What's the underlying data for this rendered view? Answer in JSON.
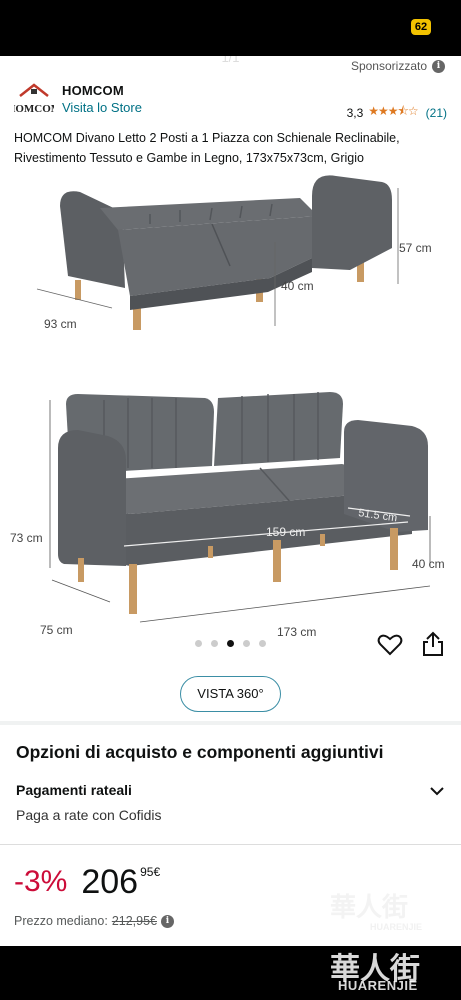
{
  "status_bar": {
    "battery": "62"
  },
  "carousel": {
    "pager": "1/1",
    "active_index": 3,
    "dot_count": 5
  },
  "ad": {
    "sponsored_label": "Sponsorizzato",
    "info_icon": "i"
  },
  "brand": {
    "name": "HOMCOM",
    "store_link": "Visita lo Store",
    "rating_value": "3,3",
    "rating_stars": "★★★⯪☆",
    "rating_count": "(21)"
  },
  "product": {
    "title": "HOMCOM Divano Letto 2 Posti a 1 Piazza con Schienale Reclinabile, Rivestimento Tessuto e Gambe in Legno, 173x75x73cm, Grigio"
  },
  "image_labels": {
    "bed_height": "57 cm",
    "bed_depth": "93 cm",
    "bed_leg_height": "40 cm",
    "sofa_height": "73 cm",
    "seat_width": "159 cm",
    "seat_depth": "51.5 cm",
    "seat_height": "40 cm",
    "sofa_depth": "75 cm",
    "sofa_width": "173 cm"
  },
  "buttons": {
    "vista_360": "VISTA 360°"
  },
  "options": {
    "title": "Opzioni di acquisto e componenti aggiuntivi",
    "payments_label": "Pagamenti rateali",
    "payments_sub": "Paga a rate con Cofidis"
  },
  "price": {
    "discount": "-3%",
    "whole": "206",
    "fraction": "95",
    "currency": "€",
    "median_label": "Prezzo mediano:",
    "median_price": "212,95€"
  },
  "watermark": {
    "logo_text": "華人街",
    "site": "HUARENJIE"
  },
  "colors": {
    "link": "#007185",
    "discount": "#cc0c39",
    "star": "#de7921",
    "sofa": "#5f6266",
    "wood": "#c89a63"
  }
}
